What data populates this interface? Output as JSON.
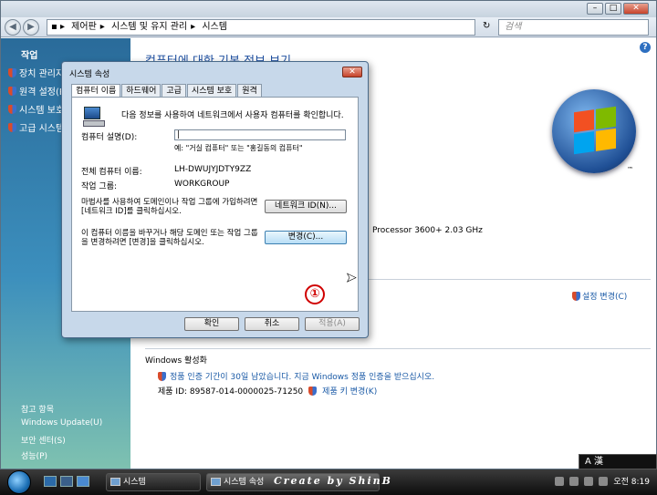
{
  "address": {
    "breadcrumbs": [
      "제어판",
      "시스템 및 유지 관리",
      "시스템"
    ],
    "search_placeholder": "검색"
  },
  "sidebar": {
    "tasks_heading": "작업",
    "items": [
      {
        "label": "장치 관리자"
      },
      {
        "label": "원격 설정(R)"
      },
      {
        "label": "시스템 보호"
      },
      {
        "label": "고급 시스템"
      }
    ],
    "see_also": "참고 항목",
    "footer_links": [
      "Windows Update(U)",
      "보안 센터(S)",
      "성능(P)"
    ]
  },
  "main": {
    "title": "컴퓨터에 대한 기본 정보 보기",
    "processor_text": "Processor 3600+  2.03 GHz",
    "change_settings": "설정 변경(C)",
    "activation_heading": "Windows 활성화",
    "activation_text": "정품 인증 기간이 30일 남았습니다. 지금 Windows 정품 인증을 받으십시오.",
    "product_id": "제품 ID: 89587-014-0000025-71250",
    "change_key": "제품 키 변경(K)"
  },
  "dialog": {
    "title": "시스템 속성",
    "tabs": [
      "컴퓨터 이름",
      "하드웨어",
      "고급",
      "시스템 보호",
      "원격"
    ],
    "intro": "다음 정보를 사용하여 네트워크에서 사용자 컴퓨터를 확인합니다.",
    "desc_label": "컴퓨터 설명(D):",
    "desc_value": "",
    "desc_hint": "예: \"거실 컴퓨터\" 또는 \"홍길동의 컴퓨터\"",
    "fullname_label": "전체 컴퓨터 이름:",
    "fullname_value": "LH-DWUJYJDTY9ZZ",
    "workgroup_label": "작업 그룹:",
    "workgroup_value": "WORKGROUP",
    "network_desc": "마법사를 사용하여 도메인이나 작업 그룹에 가입하려면 [네트워크 ID]를 클릭하십시오.",
    "network_button": "네트워크 ID(N)...",
    "rename_desc": "이 컴퓨터 이름을 바꾸거나 해당 도메인 또는 작업 그룹을 변경하려면 [변경]을 클릭하십시오.",
    "change_button": "변경(C)...",
    "ok": "확인",
    "cancel": "취소",
    "apply": "적용(A)"
  },
  "annotation": {
    "marker": "①"
  },
  "taskbar": {
    "tasks": [
      {
        "label": "시스템",
        "active": false
      },
      {
        "label": "시스템 속성",
        "active": true
      }
    ],
    "credit": "Create by ShinB",
    "clock": "오전 8:19",
    "langbar": "A 漢"
  },
  "colors": {
    "accent": "#1e4fa0",
    "sidebar": "#2a6b9a",
    "marker": "#d00000"
  }
}
